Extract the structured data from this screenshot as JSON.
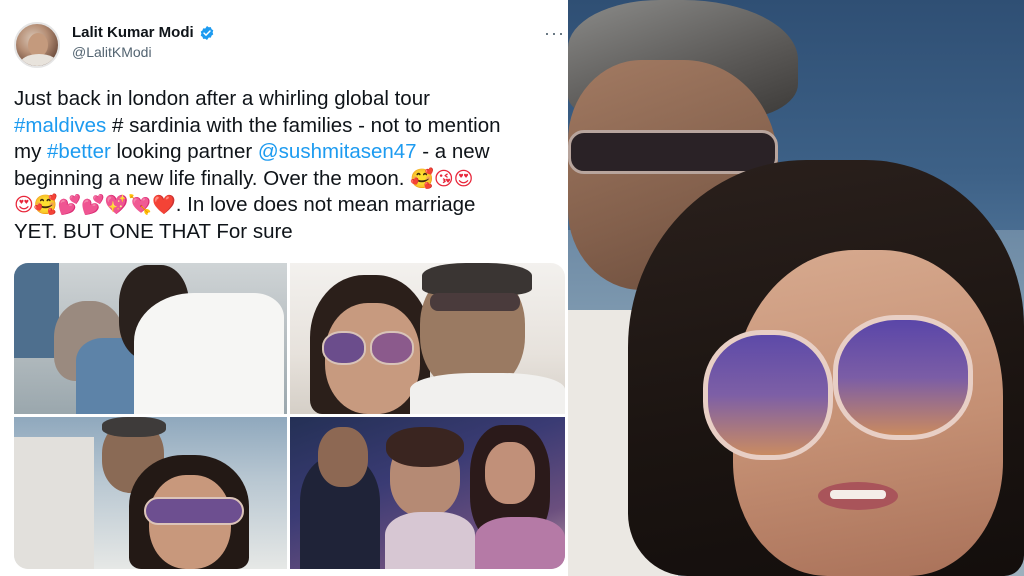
{
  "tweet": {
    "display_name": "Lalit Kumar Modi",
    "handle": "@LalitKModi",
    "text": {
      "line1": "Just back in london after a whirling global tour",
      "hashtag_maldives": "#maldives",
      "after_maldives": " # sardinia with the families - not to mention",
      "my": "my ",
      "hashtag_better": "#better",
      "after_better": " looking partner ",
      "mention": "@sushmitasen47",
      "after_mention": " - a new",
      "line4": "beginning a new life finally. Over the moon. ",
      "emojis_line4": "🥰😘😍",
      "emojis_line5": "😍🥰💕💕💖💘❤️",
      "after_emojis": ". In love does not mean marriage",
      "line6": "YET. BUT ONE THAT For sure"
    }
  },
  "icons": {
    "verified": "verified-badge-icon",
    "more": "more-options-icon"
  },
  "colors": {
    "link_blue": "#1d9bf0",
    "verified_blue": "#1d9bf0",
    "text_primary": "#0f1419",
    "text_secondary": "#536471"
  }
}
